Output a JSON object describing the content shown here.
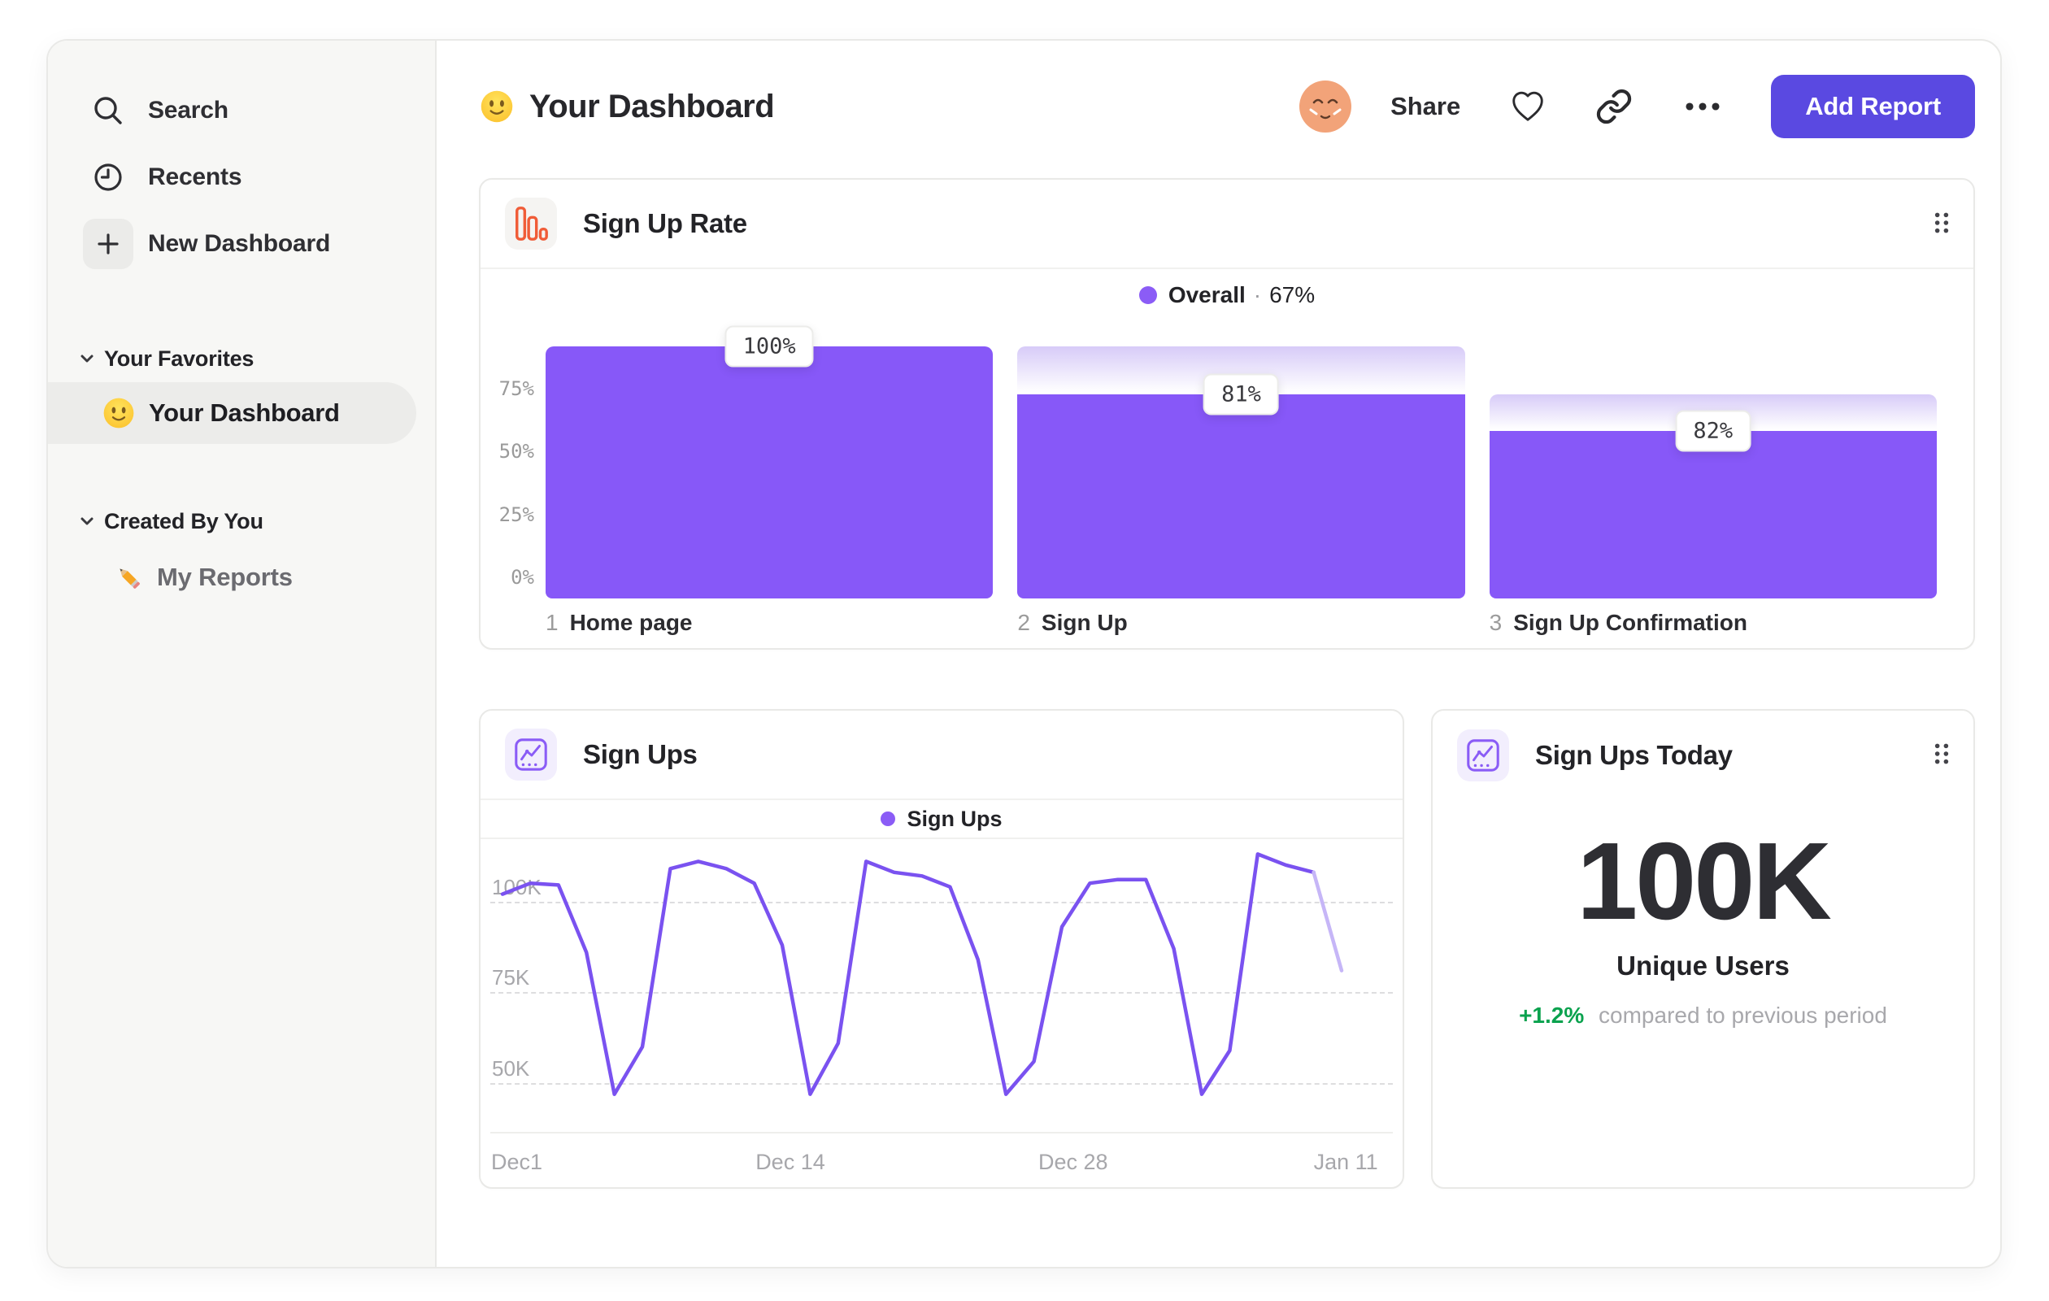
{
  "header": {
    "title": "Your Dashboard",
    "share_label": "Share",
    "add_report_label": "Add Report"
  },
  "sidebar": {
    "nav": [
      {
        "icon": "search-icon",
        "label": "Search"
      },
      {
        "icon": "clock-icon",
        "label": "Recents"
      },
      {
        "icon": "plus-icon",
        "label": "New Dashboard"
      }
    ],
    "sections": [
      {
        "label": "Your Favorites",
        "items": [
          {
            "icon": "smiley-emoji",
            "label": "Your Dashboard",
            "selected": true
          }
        ]
      },
      {
        "label": "Created By You",
        "items": [
          {
            "icon": "pencil-emoji",
            "label": "My Reports",
            "selected": false
          }
        ]
      }
    ]
  },
  "cards": {
    "funnel": {
      "title": "Sign Up Rate"
    },
    "line": {
      "title": "Sign Ups"
    },
    "metric": {
      "title": "Sign Ups Today",
      "value": "100K",
      "value_label": "Unique Users",
      "delta": "+1.2%",
      "delta_text": "compared to previous period",
      "delta_color": "#0aa24e"
    }
  },
  "chart_data": [
    {
      "type": "bar",
      "chart_title": "Sign Up Rate",
      "legend": {
        "label": "Overall",
        "separator": "·",
        "value": "67%",
        "color": "#8b5cf6"
      },
      "categories": [
        "Home page",
        "Sign Up",
        "Sign Up Confirmation"
      ],
      "step_numbers": [
        "1",
        "2",
        "3"
      ],
      "step_conversion_labels": [
        "100%",
        "81%",
        "82%"
      ],
      "bar_heights_pct": [
        100,
        81,
        66.4
      ],
      "ghost_top_pct": [
        100,
        100,
        81
      ],
      "y_ticks": [
        {
          "label": "0%",
          "value": 0
        },
        {
          "label": "25%",
          "value": 25
        },
        {
          "label": "50%",
          "value": 50
        },
        {
          "label": "75%",
          "value": 75
        }
      ],
      "ylim": [
        0,
        100
      ],
      "bar_color": "#8758f8",
      "ghost_gradient_top": "#d7cbf8",
      "grid": false,
      "legend_position": "top-center"
    },
    {
      "type": "line",
      "chart_title": "Sign Ups",
      "legend": {
        "label": "Sign Ups",
        "color": "#8b5cf6"
      },
      "x_range": "Dec 1 - Jan 13",
      "x_ticks": [
        {
          "label": "Dec1",
          "frac": 0.017
        },
        {
          "label": "Dec 14",
          "frac": 0.343
        },
        {
          "label": "Dec 28",
          "frac": 0.68
        },
        {
          "label": "Jan 11",
          "frac": 1.005
        }
      ],
      "y_ticks": [
        {
          "label": "100K",
          "value": 100
        },
        {
          "label": "75K",
          "value": 75
        },
        {
          "label": "50K",
          "value": 50
        }
      ],
      "values_k": [
        102,
        105,
        104.5,
        86,
        47,
        60,
        109,
        111,
        109,
        105,
        88,
        47,
        61,
        111,
        108,
        107,
        104,
        84,
        47,
        56,
        93,
        105,
        106,
        106,
        87,
        47,
        59,
        113,
        110,
        108,
        81
      ],
      "last_segment_projected": true,
      "ylim_k": [
        40,
        116
      ],
      "line_color": "#7a52f0",
      "projected_color": "#c6b6f7",
      "grid": "dashed-horizontal",
      "legend_position": "top-center"
    }
  ]
}
